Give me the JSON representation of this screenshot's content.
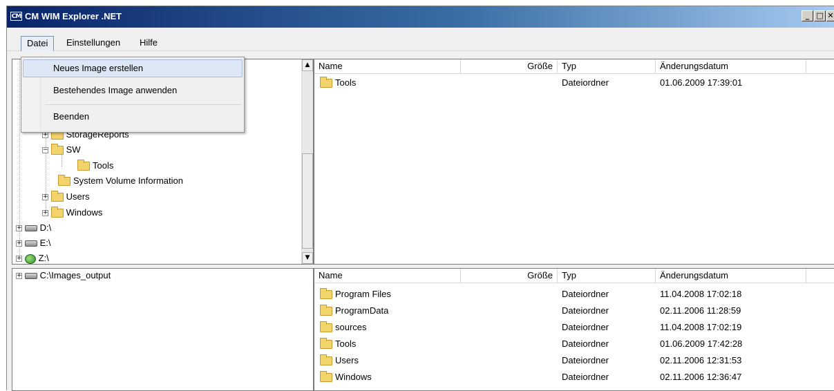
{
  "window": {
    "title": "CM WIM Explorer .NET",
    "app_icon_text": "CM",
    "controls": {
      "minimize": "_",
      "maximize": "□",
      "close": "✕"
    }
  },
  "menubar": {
    "items": [
      "Datei",
      "Einstellungen",
      "Hilfe"
    ]
  },
  "dropdown": {
    "items": [
      "Neues Image erstellen",
      "Bestehendes Image anwenden",
      "Beenden"
    ]
  },
  "source_tree": {
    "items": [
      {
        "label": "StorageReports",
        "expander": "+",
        "icon": "folder-icon"
      },
      {
        "label": "SW",
        "expander": "−",
        "icon": "folder-icon"
      },
      {
        "label": "Tools",
        "expander": "",
        "icon": "folder-icon"
      },
      {
        "label": "System Volume Information",
        "expander": "",
        "icon": "folder-icon"
      },
      {
        "label": "Users",
        "expander": "+",
        "icon": "folder-icon"
      },
      {
        "label": "Windows",
        "expander": "+",
        "icon": "folder-icon"
      },
      {
        "label": "D:\\",
        "expander": "+",
        "icon": "drive-icon"
      },
      {
        "label": "E:\\",
        "expander": "+",
        "icon": "drive-icon"
      },
      {
        "label": "Z:\\",
        "expander": "+",
        "icon": "network-drive-icon"
      }
    ]
  },
  "columns": {
    "name": "Name",
    "size": "Größe",
    "type": "Typ",
    "modified": "Änderungsdatum"
  },
  "source_list": {
    "rows": [
      {
        "name": "Tools",
        "type": "Dateiordner",
        "modified": "01.06.2009 17:39:01"
      }
    ]
  },
  "target_tree": {
    "items": [
      {
        "label": "C:\\Images_output",
        "expander": "+",
        "icon": "drive-icon"
      }
    ]
  },
  "target_list": {
    "rows": [
      {
        "name": "Program Files",
        "type": "Dateiordner",
        "modified": "11.04.2008 17:02:18"
      },
      {
        "name": "ProgramData",
        "type": "Dateiordner",
        "modified": "02.11.2006 11:28:59"
      },
      {
        "name": "sources",
        "type": "Dateiordner",
        "modified": "11.04.2008 17:02:19"
      },
      {
        "name": "Tools",
        "type": "Dateiordner",
        "modified": "01.06.2009 17:42:28"
      },
      {
        "name": "Users",
        "type": "Dateiordner",
        "modified": "02.11.2006 12:31:53"
      },
      {
        "name": "Windows",
        "type": "Dateiordner",
        "modified": "02.11.2006 12:36:47"
      }
    ]
  }
}
